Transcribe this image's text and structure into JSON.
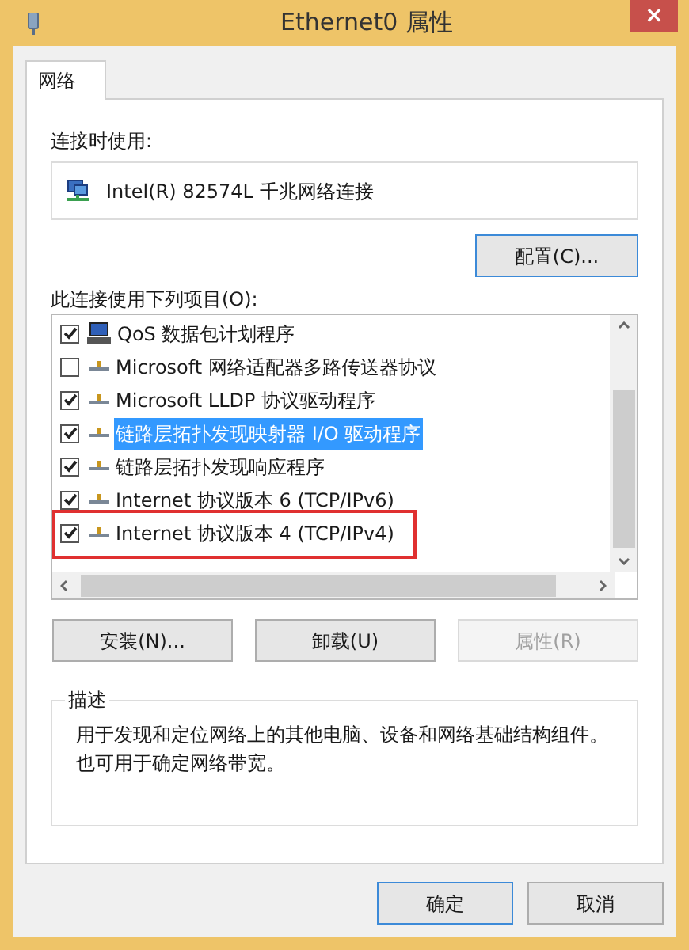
{
  "window": {
    "title": "Ethernet0 属性",
    "close": "×"
  },
  "tabs": [
    {
      "label": "网络",
      "selected": true
    }
  ],
  "connect_using": {
    "label": "连接时使用:",
    "adapter": "Intel(R) 82574L 千兆网络连接",
    "configure_button": "配置(C)..."
  },
  "items": {
    "label": "此连接使用下列项目(O):",
    "list": [
      {
        "kind": "service",
        "text": "QoS 数据包计划程序",
        "checked": true,
        "selected": false,
        "highlighted": false
      },
      {
        "kind": "protocol",
        "text": "Microsoft 网络适配器多路传送器协议",
        "checked": false,
        "selected": false,
        "highlighted": false
      },
      {
        "kind": "protocol",
        "text": "Microsoft LLDP 协议驱动程序",
        "checked": true,
        "selected": false,
        "highlighted": false
      },
      {
        "kind": "protocol",
        "text": "链路层拓扑发现映射器 I/O 驱动程序",
        "checked": true,
        "selected": true,
        "highlighted": false
      },
      {
        "kind": "protocol",
        "text": "链路层拓扑发现响应程序",
        "checked": true,
        "selected": false,
        "highlighted": false
      },
      {
        "kind": "protocol",
        "text": "Internet 协议版本 6 (TCP/IPv6)",
        "checked": true,
        "selected": false,
        "highlighted": false
      },
      {
        "kind": "protocol",
        "text": "Internet 协议版本 4 (TCP/IPv4)",
        "checked": true,
        "selected": false,
        "highlighted": true
      }
    ]
  },
  "item_buttons": [
    {
      "label": "安装(N)...",
      "disabled": false
    },
    {
      "label": "卸载(U)",
      "disabled": false
    },
    {
      "label": "属性(R)",
      "disabled": true
    }
  ],
  "description": {
    "label": "描述",
    "text": "用于发现和定位网络上的其他电脑、设备和网络基础结构组件。也可用于确定网络带宽。"
  },
  "dialog_buttons": [
    {
      "label": "确定",
      "default": true
    },
    {
      "label": "取消",
      "default": false
    }
  ]
}
